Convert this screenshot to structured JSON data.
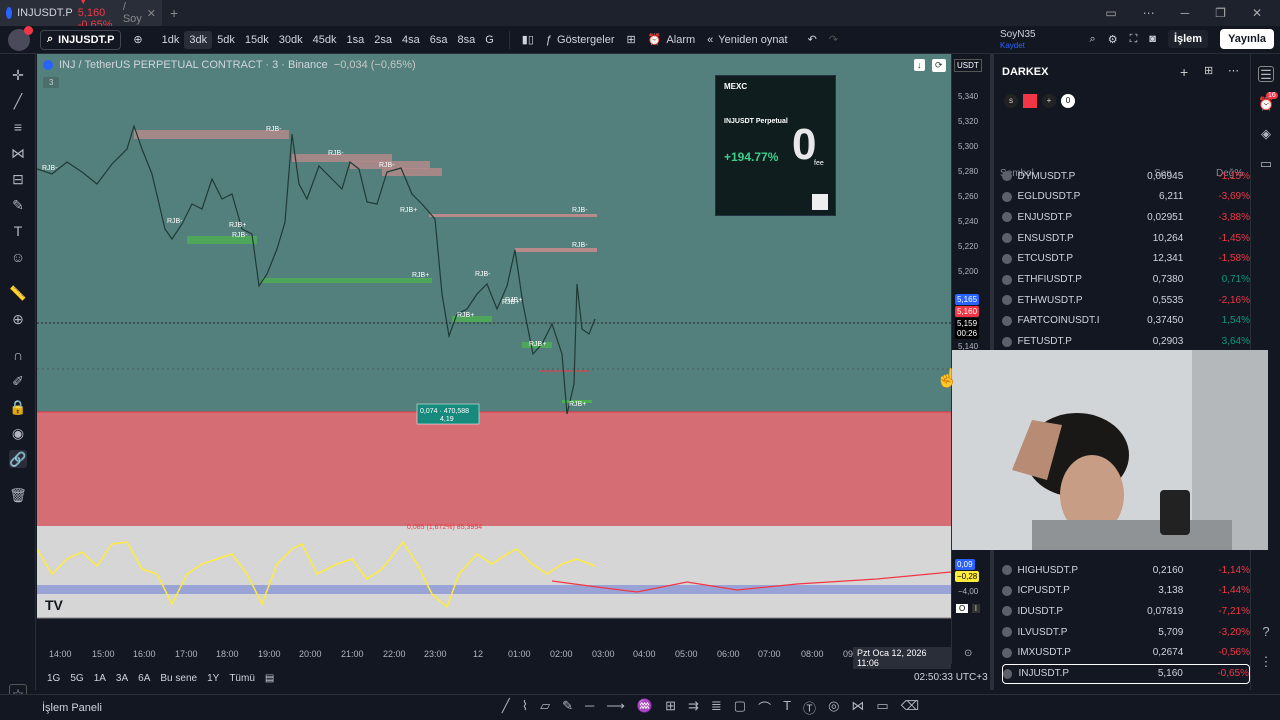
{
  "browser_tab": {
    "symbol": "INJUSDT.P",
    "price": "5,160",
    "change": "-0.65%",
    "rest": "/ Soy"
  },
  "toolbar": {
    "symbol": "INJUSDT.P",
    "timeframes": [
      "1dk",
      "3dk",
      "5dk",
      "15dk",
      "30dk",
      "45dk",
      "1sa",
      "2sa",
      "4sa",
      "6sa",
      "8sa",
      "G"
    ],
    "active_timeframe": "3dk",
    "indicators_label": "Göstergeler",
    "alarm_label": "Alarm",
    "replay_label": "Yeniden oynat",
    "user_name": "SoyN35",
    "user_status": "Kaydet",
    "trade_label": "İşlem",
    "publish_label": "Yayınla"
  },
  "chart": {
    "title": "INJ / TetherUS PERPETUAL CONTRACT · 3 · Binance",
    "change": "−0,034 (−0,65%)",
    "currency": "USDT",
    "counter_badge": "3",
    "price_labels": [
      "5,340",
      "5,320",
      "5,300",
      "5,280",
      "5,260",
      "5,240",
      "5,220",
      "5,200",
      "5,180",
      "5,140"
    ],
    "current_price_blue": "5,165",
    "current_price_red": "5,160",
    "current_price_black": "5,159",
    "countdown": "00:26",
    "measure_box": "0,074 · 470,588",
    "measure_sub": "4,19",
    "red_zone_label": "0,085 (1,672%) 85,3954",
    "ob_labels": [
      "RJB-",
      "RJB-",
      "RJB-",
      "RJB-",
      "RJB-",
      "RJB-",
      "RJB+",
      "RJB-",
      "RJB-",
      "RJB+",
      "RJB+",
      "RJB+",
      "RJB-",
      "RJB+",
      "RJB+",
      "RJB+",
      "RJB+"
    ],
    "oscillator_labels": [
      "0,09",
      "−0,28",
      "−4,00"
    ],
    "time_labels": [
      "14:00",
      "15:00",
      "16:00",
      "17:00",
      "18:00",
      "19:00",
      "20:00",
      "21:00",
      "22:00",
      "23:00",
      "12",
      "01:00",
      "02:00",
      "03:00",
      "04:00",
      "05:00",
      "06:00",
      "07:00",
      "08:00",
      "09"
    ],
    "crosshair_time": "Pzt Oca 12, 2026",
    "crosshair_clock": "11:06"
  },
  "ad": {
    "brand": "MEXC",
    "product": "INJUSDT Perpetual",
    "percent": "+194.77%",
    "zero": "0",
    "fee": "fee"
  },
  "bottom": {
    "ranges": [
      "1G",
      "5G",
      "1A",
      "3A",
      "6A",
      "Bu sene",
      "1Y",
      "Tümü"
    ],
    "utc": "02:50:33 UTC+3",
    "panel_label": "İşlem Paneli"
  },
  "watchlist": {
    "title": "DARKEX",
    "col_symbol": "Sembol",
    "col_last": "Son",
    "col_change": "Değ%",
    "rows": [
      {
        "s": "DYMUSDT.P",
        "l": "0,06945",
        "c": "-1,15%",
        "neg": true
      },
      {
        "s": "EGLDUSDT.P",
        "l": "6,211",
        "c": "-3,69%",
        "neg": true
      },
      {
        "s": "ENJUSDT.P",
        "l": "0,02951",
        "c": "-3,88%",
        "neg": true
      },
      {
        "s": "ENSUSDT.P",
        "l": "10,264",
        "c": "-1,45%",
        "neg": true
      },
      {
        "s": "ETCUSDT.P",
        "l": "12,341",
        "c": "-1,58%",
        "neg": true
      },
      {
        "s": "ETHFIUSDT.P",
        "l": "0,7380",
        "c": "0,71%",
        "neg": false
      },
      {
        "s": "ETHWUSDT.P",
        "l": "0,5535",
        "c": "-2,16%",
        "neg": true
      },
      {
        "s": "FARTCOINUSDT.I",
        "l": "0,37450",
        "c": "1,54%",
        "neg": false
      },
      {
        "s": "FETUSDT.P",
        "l": "0,2903",
        "c": "3,64%",
        "neg": false
      }
    ],
    "rows2": [
      {
        "s": "HIGHUSDT.P",
        "l": "0,2160",
        "c": "-1,14%",
        "neg": true
      },
      {
        "s": "ICPUSDT.P",
        "l": "3,138",
        "c": "-1,44%",
        "neg": true
      },
      {
        "s": "IDUSDT.P",
        "l": "0,07819",
        "c": "-7,21%",
        "neg": true
      },
      {
        "s": "ILVUSDT.P",
        "l": "5,709",
        "c": "-3,20%",
        "neg": true
      },
      {
        "s": "IMXUSDT.P",
        "l": "0,2674",
        "c": "-0,56%",
        "neg": true
      },
      {
        "s": "INJUSDT.P",
        "l": "5,160",
        "c": "-0,65%",
        "neg": true
      }
    ]
  },
  "colors": {
    "bg": "#131722",
    "up": "#089981",
    "down": "#f23645",
    "accent": "#2962ff",
    "osc": "#ffeb3b"
  }
}
